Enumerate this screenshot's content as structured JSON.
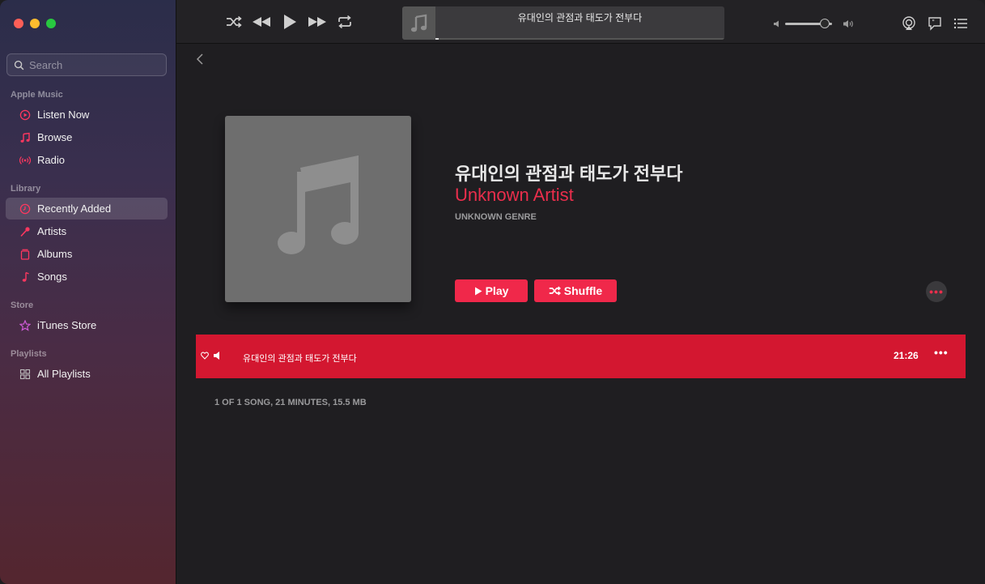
{
  "window": {
    "traffic": [
      "close",
      "minimize",
      "zoom"
    ]
  },
  "sidebar": {
    "search": {
      "placeholder": "Search",
      "value": ""
    },
    "sections": [
      {
        "label": "Apple Music"
      },
      {
        "label": "Library"
      },
      {
        "label": "Store"
      },
      {
        "label": "Playlists"
      }
    ],
    "items": [
      {
        "label": "Listen Now",
        "icon": "play-circle-icon"
      },
      {
        "label": "Browse",
        "icon": "music-note-icon"
      },
      {
        "label": "Radio",
        "icon": "radio-waves-icon"
      },
      {
        "label": "Recently Added",
        "icon": "clock-icon",
        "active": true
      },
      {
        "label": "Artists",
        "icon": "microphone-icon"
      },
      {
        "label": "Albums",
        "icon": "album-icon"
      },
      {
        "label": "Songs",
        "icon": "note-icon"
      },
      {
        "label": "iTunes Store",
        "icon": "star-icon"
      },
      {
        "label": "All Playlists",
        "icon": "grid-icon"
      }
    ],
    "accent": "#ff375f"
  },
  "toolbar": {
    "now_playing_title": "유대인의 관점과 태도가 전부다",
    "progress": 0.01,
    "volume": 0.85
  },
  "album": {
    "title": "유대인의 관점과 태도가 전부다",
    "artist": "Unknown Artist",
    "genre": "UNKNOWN GENRE",
    "play_label": "Play",
    "shuffle_label": "Shuffle"
  },
  "tracks": [
    {
      "title": "유대인의 관점과 태도가 전부다",
      "duration": "21:26"
    }
  ],
  "summary": "1 OF 1 SONG, 21 MINUTES, 15.5 MB",
  "colors": {
    "accent": "#f0284a",
    "selected_row": "#d31730"
  }
}
